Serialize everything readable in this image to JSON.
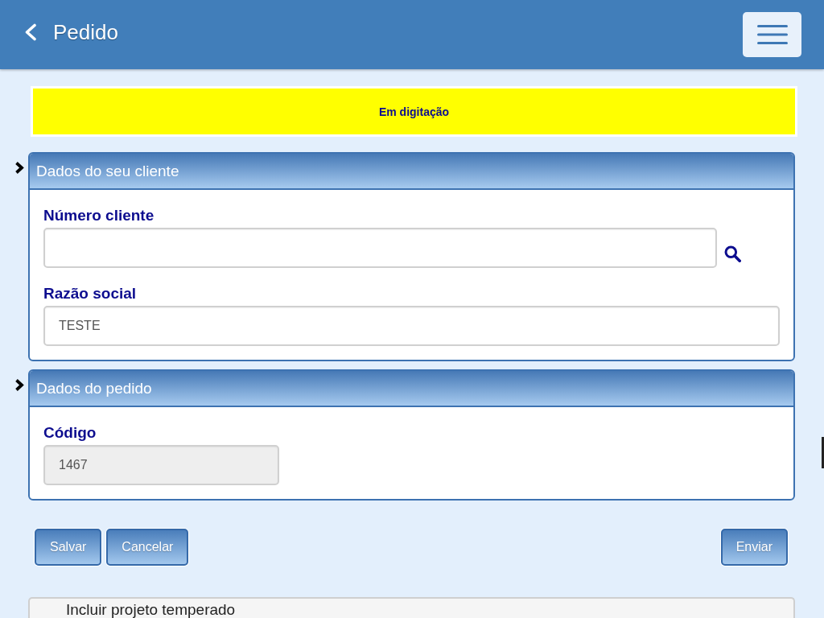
{
  "header": {
    "title": "Pedido"
  },
  "status_banner": {
    "text": "Em digitação"
  },
  "panels": [
    {
      "title": "Dados do seu cliente",
      "fields": [
        {
          "label": "Número cliente",
          "kind": "lookup",
          "disabled": false
        },
        {
          "label": "Razão social",
          "kind": "text",
          "value": "TESTE",
          "disabled": false
        }
      ]
    },
    {
      "title": "Dados do pedido",
      "fields": [
        {
          "label": "Código",
          "kind": "short",
          "value": "1467",
          "disabled": true
        }
      ]
    }
  ],
  "actions": {
    "left": [
      {
        "label": "Salvar"
      },
      {
        "label": "Cancelar"
      }
    ],
    "right": [
      {
        "label": "Enviar"
      }
    ]
  },
  "collapsed_panel": {
    "title": "Incluir projeto temperado"
  }
}
